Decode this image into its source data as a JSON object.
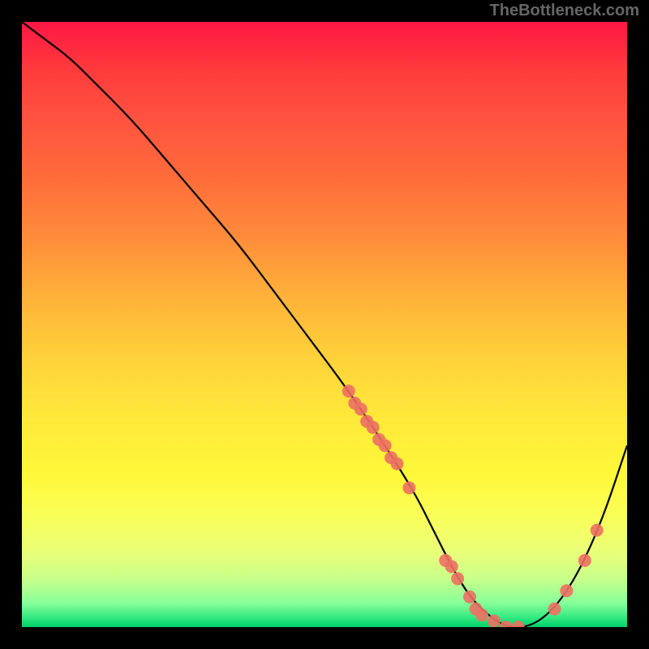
{
  "watermark": "TheBottleneck.com",
  "chart_data": {
    "type": "line",
    "title": "",
    "xlabel": "",
    "ylabel": "",
    "xlim": [
      0,
      100
    ],
    "ylim": [
      0,
      100
    ],
    "series": [
      {
        "name": "curve",
        "x": [
          0,
          4,
          8,
          12,
          18,
          24,
          30,
          36,
          42,
          48,
          54,
          60,
          65,
          68,
          71,
          74,
          77,
          80,
          84,
          88,
          92,
          96,
          100
        ],
        "y": [
          100,
          97,
          94,
          90,
          84,
          77,
          70,
          63,
          55,
          47,
          39,
          30,
          22,
          16,
          10,
          5,
          2,
          0,
          0,
          3,
          9,
          18,
          30
        ]
      }
    ],
    "markers": {
      "name": "highlight-points",
      "color": "#ec7063",
      "points": [
        {
          "x": 54,
          "y": 39
        },
        {
          "x": 55,
          "y": 37
        },
        {
          "x": 56,
          "y": 36
        },
        {
          "x": 57,
          "y": 34
        },
        {
          "x": 58,
          "y": 33
        },
        {
          "x": 59,
          "y": 31
        },
        {
          "x": 60,
          "y": 30
        },
        {
          "x": 61,
          "y": 28
        },
        {
          "x": 62,
          "y": 27
        },
        {
          "x": 64,
          "y": 23
        },
        {
          "x": 70,
          "y": 11
        },
        {
          "x": 71,
          "y": 10
        },
        {
          "x": 72,
          "y": 8
        },
        {
          "x": 74,
          "y": 5
        },
        {
          "x": 75,
          "y": 3
        },
        {
          "x": 76,
          "y": 2
        },
        {
          "x": 78,
          "y": 1
        },
        {
          "x": 80,
          "y": 0
        },
        {
          "x": 82,
          "y": 0
        },
        {
          "x": 88,
          "y": 3
        },
        {
          "x": 90,
          "y": 6
        },
        {
          "x": 93,
          "y": 11
        },
        {
          "x": 95,
          "y": 16
        }
      ]
    }
  }
}
